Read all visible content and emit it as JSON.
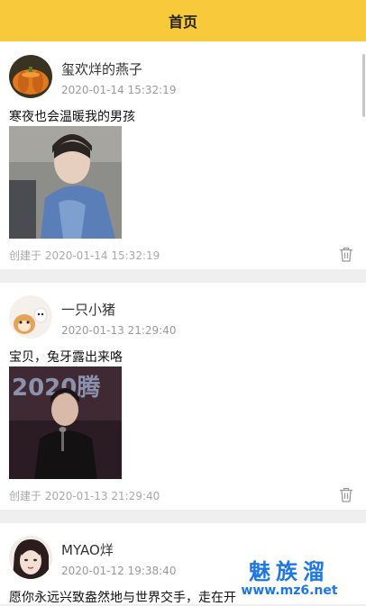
{
  "header": {
    "title": "首页"
  },
  "posts": [
    {
      "username": "玺欢烊的燕子",
      "timestamp": "2020-01-14 15:32:19",
      "text": "寒夜也会温暖我的男孩",
      "created": "创建于 2020-01-14 15:32:19"
    },
    {
      "username": "一只小猪",
      "timestamp": "2020-01-13 21:29:40",
      "text": "宝贝，兔牙露出来咯",
      "created": "创建于 2020-01-13 21:29:40",
      "image_caption": "2020腾"
    },
    {
      "username": "MYAO烊",
      "timestamp": "2020-01-12 19:38:40",
      "text": "愿你永远兴致盎然地与世界交手，走在开"
    }
  ],
  "watermark": {
    "brand": "魅族溜",
    "url": "www.mz6.net"
  },
  "colors": {
    "header": "#f8c93a",
    "watermark": "#1d78e6"
  },
  "icons": {
    "delete": "trash-icon"
  }
}
